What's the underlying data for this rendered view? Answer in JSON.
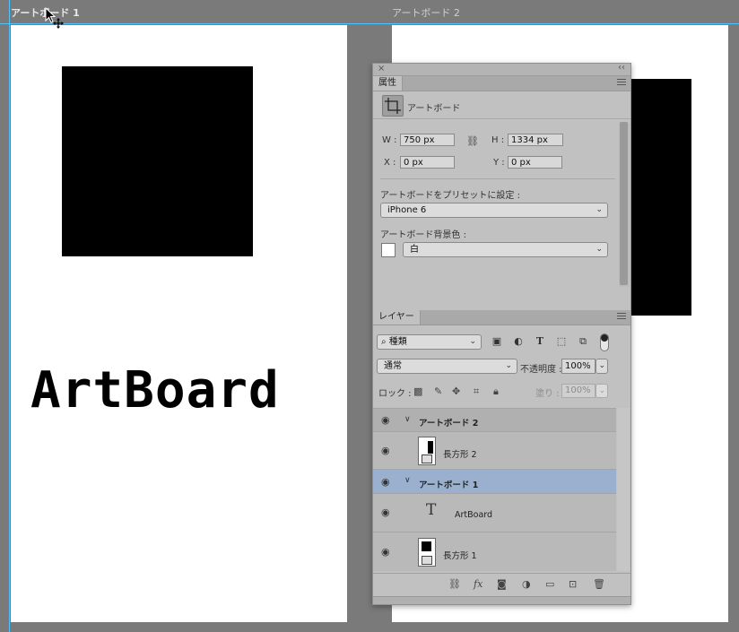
{
  "canvas": {
    "artboard1_label": "アートボード 1",
    "artboard2_label": "アートボード 2",
    "artboard_text": "ArtBoard"
  },
  "properties_panel": {
    "tab": "属性",
    "header_label": "アートボード",
    "w_label": "W :",
    "w_value": "750 px",
    "h_label": "H :",
    "h_value": "1334 px",
    "x_label": "X :",
    "x_value": "0 px",
    "y_label": "Y :",
    "y_value": "0 px",
    "preset_label": "アートボードをプリセットに設定 :",
    "preset_value": "iPhone 6",
    "bg_label": "アートボード背景色 :",
    "bg_value": "白",
    "bg_color": "#ffffff"
  },
  "layers_panel": {
    "tab": "レイヤー",
    "filter_value": "種類",
    "blend_mode": "通常",
    "opacity_label": "不透明度 :",
    "opacity_value": "100%",
    "lock_label": "ロック :",
    "fill_label": "塗り :",
    "fill_value": "100%",
    "layers": [
      {
        "name": "アートボード 2",
        "type": "artboard",
        "selected": false
      },
      {
        "name": "長方形 2",
        "type": "shape",
        "selected": false
      },
      {
        "name": "アートボード 1",
        "type": "artboard",
        "selected": true
      },
      {
        "name": "ArtBoard",
        "type": "text",
        "selected": false
      },
      {
        "name": "長方形 1",
        "type": "shape",
        "selected": false
      }
    ]
  },
  "colors": {
    "pasteboard": "#7a7a7a",
    "panel_bg": "#c1c1c1",
    "selected_row": "#9bb0cf",
    "guide": "#4ec3ff"
  }
}
